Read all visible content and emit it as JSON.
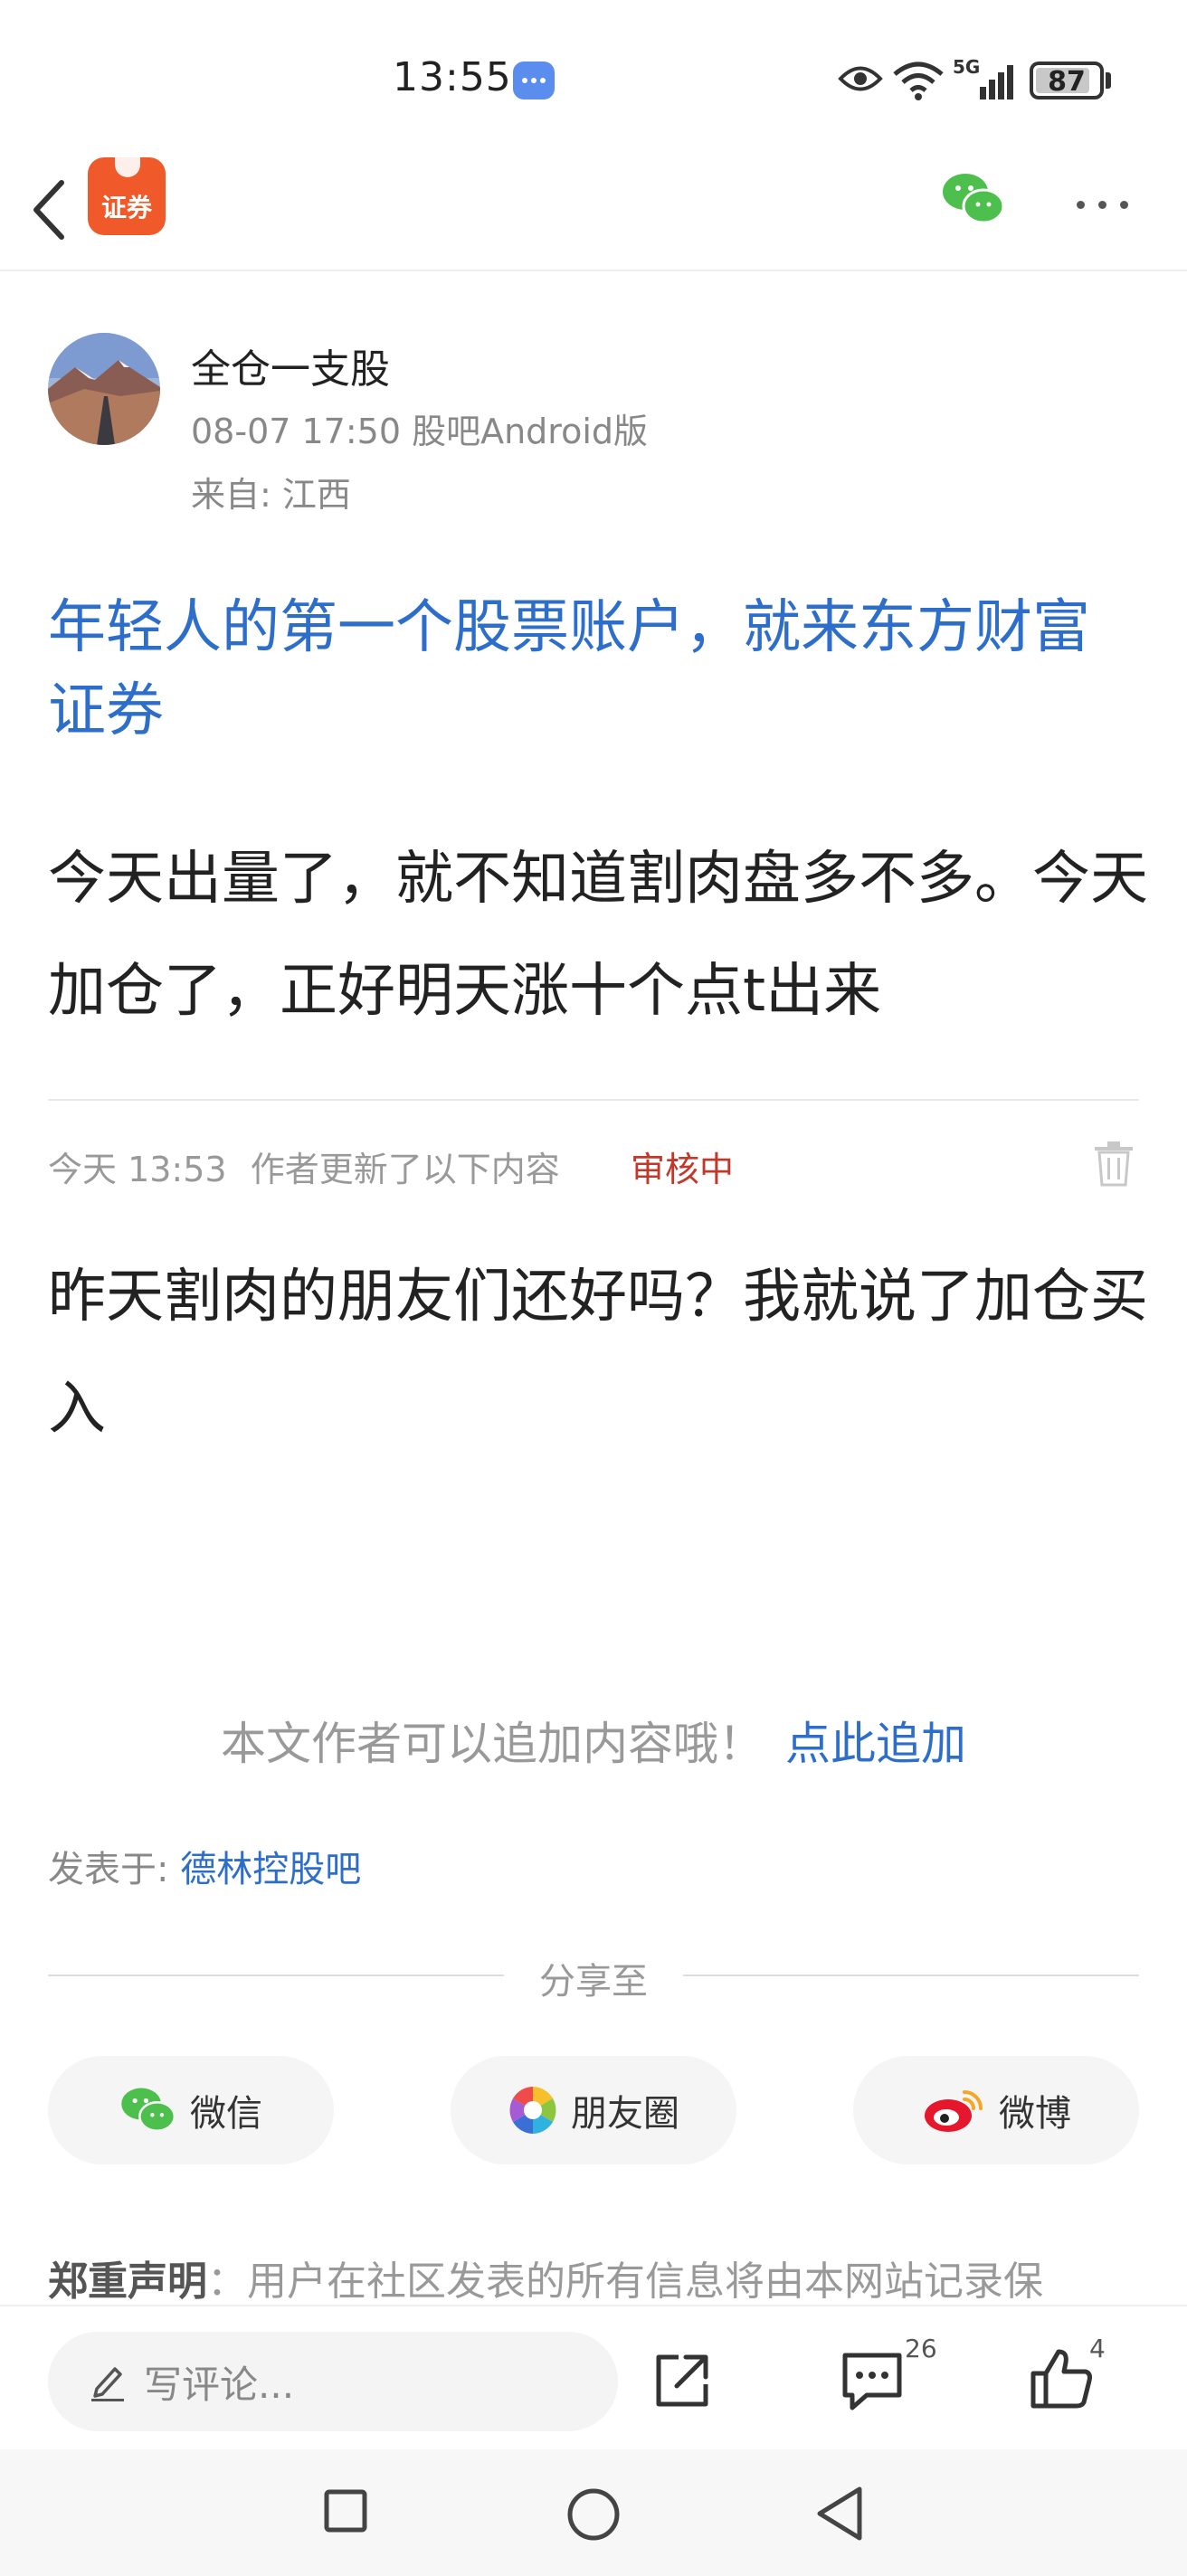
{
  "status_bar": {
    "time": "13:55",
    "network": "5G",
    "battery": "87",
    "battery_level_pct": 87
  },
  "nav": {
    "app_logo_label": "证券",
    "icons": [
      "back-arrow-icon",
      "wechat-icon",
      "more-icon"
    ]
  },
  "author": {
    "name": "全仓一支股",
    "meta": "08-07 17:50 股吧Android版",
    "location": "来自: 江西"
  },
  "post": {
    "ad_headline": "年轻人的第一个股票账户，就来东方财富证券",
    "body": "今天出量了，就不知道割肉盘多不多。今天加仓了，正好明天涨十个点t出来"
  },
  "update": {
    "time": "今天 13:53",
    "note": "作者更新了以下内容",
    "status": "审核中",
    "body": "昨天割肉的朋友们还好吗？我就说了加仓买入"
  },
  "append": {
    "tip": "本文作者可以追加内容哦！",
    "link": "点此追加"
  },
  "published": {
    "label": "发表于:",
    "forum": "德林控股吧"
  },
  "share": {
    "title": "分享至",
    "buttons": [
      {
        "label": "微信",
        "icon": "wechat-icon"
      },
      {
        "label": "朋友圈",
        "icon": "moments-icon"
      },
      {
        "label": "微博",
        "icon": "weibo-icon"
      }
    ]
  },
  "disclaimer": {
    "label": "郑重声明",
    "text": "：用户在社区发表的所有信息将由本网站记录保"
  },
  "action_bar": {
    "comment_placeholder": "写评论...",
    "comment_count": "26",
    "like_count": "4"
  },
  "colors": {
    "link_blue": "#2d6ecb",
    "brand_orange": "#f0592a",
    "review_red": "#c0392b",
    "wechat_green": "#4cbf4c"
  }
}
